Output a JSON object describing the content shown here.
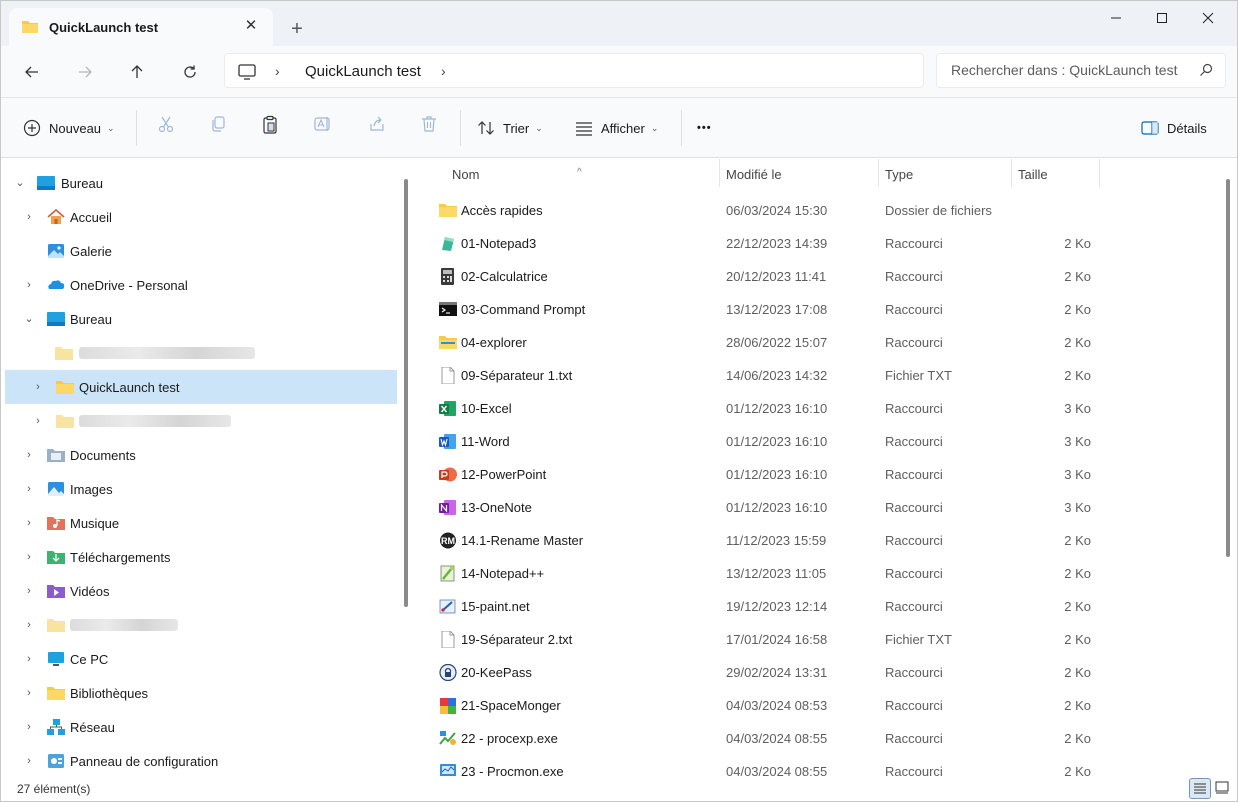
{
  "window": {
    "tab_title": "QuickLaunch test",
    "tab_close": "✕",
    "new_tab": "+"
  },
  "address": {
    "segment": "QuickLaunch test"
  },
  "search": {
    "placeholder": "Rechercher dans : QuickLaunch test"
  },
  "commandbar": {
    "new_label": "Nouveau",
    "sort_label": "Trier",
    "view_label": "Afficher",
    "more_label": "•••",
    "details_label": "Détails"
  },
  "sidebar": {
    "items": [
      {
        "label": "Bureau",
        "icon": "desktop-icon",
        "expanded": true
      },
      {
        "label": "Accueil",
        "icon": "home-icon"
      },
      {
        "label": "Galerie",
        "icon": "gallery-icon"
      },
      {
        "label": "OneDrive - Personal",
        "icon": "onedrive-icon"
      },
      {
        "label": "Bureau",
        "icon": "desktop-icon",
        "expanded": true
      },
      {
        "label": "QuickLaunch test",
        "icon": "folder-icon",
        "selected": true
      },
      {
        "label": "Documents",
        "icon": "documents-icon"
      },
      {
        "label": "Images",
        "icon": "pictures-icon"
      },
      {
        "label": "Musique",
        "icon": "music-icon"
      },
      {
        "label": "Téléchargements",
        "icon": "downloads-icon"
      },
      {
        "label": "Vidéos",
        "icon": "videos-icon"
      },
      {
        "label": "Ce PC",
        "icon": "this-pc-icon"
      },
      {
        "label": "Bibliothèques",
        "icon": "libraries-icon"
      },
      {
        "label": "Réseau",
        "icon": "network-icon"
      },
      {
        "label": "Panneau de configuration",
        "icon": "control-panel-icon"
      }
    ]
  },
  "filelist": {
    "columns": {
      "name": "Nom",
      "modified": "Modifié le",
      "type": "Type",
      "size": "Taille"
    },
    "rows": [
      {
        "name": "Accès rapides",
        "modified": "06/03/2024 15:30",
        "type": "Dossier de fichiers",
        "size": "",
        "icon": "folder-icon"
      },
      {
        "name": "01-Notepad3",
        "modified": "22/12/2023 14:39",
        "type": "Raccourci",
        "size": "2 Ko",
        "icon": "notepad3-icon"
      },
      {
        "name": "02-Calculatrice",
        "modified": "20/12/2023 11:41",
        "type": "Raccourci",
        "size": "2 Ko",
        "icon": "calculator-icon"
      },
      {
        "name": "03-Command Prompt",
        "modified": "13/12/2023 17:08",
        "type": "Raccourci",
        "size": "2 Ko",
        "icon": "cmd-icon"
      },
      {
        "name": "04-explorer",
        "modified": "28/06/2022 15:07",
        "type": "Raccourci",
        "size": "2 Ko",
        "icon": "explorer-icon"
      },
      {
        "name": "09-Séparateur 1.txt",
        "modified": "14/06/2023 14:32",
        "type": "Fichier TXT",
        "size": "2 Ko",
        "icon": "txt-file-icon"
      },
      {
        "name": "10-Excel",
        "modified": "01/12/2023 16:10",
        "type": "Raccourci",
        "size": "3 Ko",
        "icon": "excel-icon"
      },
      {
        "name": "11-Word",
        "modified": "01/12/2023 16:10",
        "type": "Raccourci",
        "size": "3 Ko",
        "icon": "word-icon"
      },
      {
        "name": "12-PowerPoint",
        "modified": "01/12/2023 16:10",
        "type": "Raccourci",
        "size": "3 Ko",
        "icon": "powerpoint-icon"
      },
      {
        "name": "13-OneNote",
        "modified": "01/12/2023 16:10",
        "type": "Raccourci",
        "size": "3 Ko",
        "icon": "onenote-icon"
      },
      {
        "name": "14.1-Rename Master",
        "modified": "11/12/2023 15:59",
        "type": "Raccourci",
        "size": "2 Ko",
        "icon": "rename-master-icon"
      },
      {
        "name": "14-Notepad++",
        "modified": "13/12/2023 11:05",
        "type": "Raccourci",
        "size": "2 Ko",
        "icon": "notepad-plus-plus-icon"
      },
      {
        "name": "15-paint.net",
        "modified": "19/12/2023 12:14",
        "type": "Raccourci",
        "size": "2 Ko",
        "icon": "paintnet-icon"
      },
      {
        "name": "19-Séparateur 2.txt",
        "modified": "17/01/2024 16:58",
        "type": "Fichier TXT",
        "size": "2 Ko",
        "icon": "txt-file-icon"
      },
      {
        "name": "20-KeePass",
        "modified": "29/02/2024 13:31",
        "type": "Raccourci",
        "size": "2 Ko",
        "icon": "keepass-icon"
      },
      {
        "name": "21-SpaceMonger",
        "modified": "04/03/2024 08:53",
        "type": "Raccourci",
        "size": "2 Ko",
        "icon": "spacemonger-icon"
      },
      {
        "name": "22 - procexp.exe",
        "modified": "04/03/2024 08:55",
        "type": "Raccourci",
        "size": "2 Ko",
        "icon": "procexp-icon"
      },
      {
        "name": "23 - Procmon.exe",
        "modified": "04/03/2024 08:55",
        "type": "Raccourci",
        "size": "2 Ko",
        "icon": "procmon-icon"
      }
    ]
  },
  "status": {
    "count": "27 élément(s)"
  },
  "colors": {
    "accent": "#0067c0",
    "selection": "#cce4f7",
    "folder": "#f8c94a"
  }
}
